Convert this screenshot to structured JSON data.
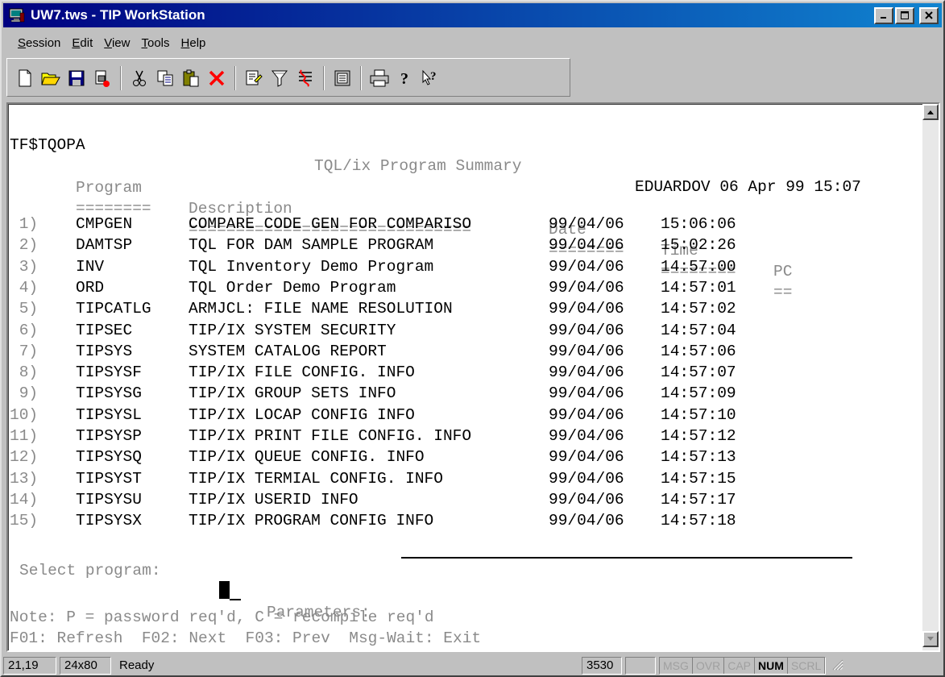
{
  "window": {
    "title": "UW7.tws - TIP WorkStation",
    "buttons": {
      "minimize": "_",
      "maximize": "□",
      "close": "✕"
    }
  },
  "menu": [
    "Session",
    "Edit",
    "View",
    "Tools",
    "Help"
  ],
  "menu_underline": [
    "S",
    "E",
    "V",
    "T",
    "H"
  ],
  "toolbar": {
    "icons": [
      "new-icon",
      "open-icon",
      "save-icon",
      "properties-icon",
      "cut-icon",
      "copy-icon",
      "paste-icon",
      "delete-icon",
      "settings-icon",
      "filter-icon",
      "macro-icon",
      "display-icon",
      "print-icon",
      "help-icon",
      "context-help-icon"
    ]
  },
  "screen": {
    "program_id": "TF$TQOPA",
    "title": "TQL/ix Program Summary",
    "user_datetime": "EDUARDOV 06 Apr 99 15:07",
    "headers": {
      "program": "Program",
      "description": "Description",
      "date": "Date",
      "time": "Time",
      "pc": "PC"
    },
    "underlines": {
      "program": "========",
      "description": "==============================",
      "date": "========",
      "time": "========",
      "pc": "=="
    },
    "rows": [
      {
        "num": " 1)",
        "program": "CMPGEN",
        "description": "COMPARE CODE GEN FOR COMPARISO",
        "date": "99/04/06",
        "time": "15:06:06"
      },
      {
        "num": " 2)",
        "program": "DAMTSP",
        "description": "TQL FOR DAM SAMPLE PROGRAM",
        "date": "99/04/06",
        "time": "15:02:26"
      },
      {
        "num": " 3)",
        "program": "INV",
        "description": "TQL Inventory Demo Program",
        "date": "99/04/06",
        "time": "14:57:00"
      },
      {
        "num": " 4)",
        "program": "ORD",
        "description": "TQL Order Demo Program",
        "date": "99/04/06",
        "time": "14:57:01"
      },
      {
        "num": " 5)",
        "program": "TIPCATLG",
        "description": "ARMJCL: FILE NAME RESOLUTION",
        "date": "99/04/06",
        "time": "14:57:02"
      },
      {
        "num": " 6)",
        "program": "TIPSEC",
        "description": "TIP/IX SYSTEM SECURITY",
        "date": "99/04/06",
        "time": "14:57:04"
      },
      {
        "num": " 7)",
        "program": "TIPSYS",
        "description": "SYSTEM CATALOG REPORT",
        "date": "99/04/06",
        "time": "14:57:06"
      },
      {
        "num": " 8)",
        "program": "TIPSYSF",
        "description": "TIP/IX FILE CONFIG. INFO",
        "date": "99/04/06",
        "time": "14:57:07"
      },
      {
        "num": " 9)",
        "program": "TIPSYSG",
        "description": "TIP/IX GROUP SETS INFO",
        "date": "99/04/06",
        "time": "14:57:09"
      },
      {
        "num": "10)",
        "program": "TIPSYSL",
        "description": "TIP/IX LOCAP CONFIG INFO",
        "date": "99/04/06",
        "time": "14:57:10"
      },
      {
        "num": "11)",
        "program": "TIPSYSP",
        "description": "TIP/IX PRINT FILE CONFIG. INFO",
        "date": "99/04/06",
        "time": "14:57:12"
      },
      {
        "num": "12)",
        "program": "TIPSYSQ",
        "description": "TIP/IX QUEUE CONFIG. INFO",
        "date": "99/04/06",
        "time": "14:57:13"
      },
      {
        "num": "13)",
        "program": "TIPSYST",
        "description": "TIP/IX TERMIAL CONFIG. INFO",
        "date": "99/04/06",
        "time": "14:57:15"
      },
      {
        "num": "14)",
        "program": "TIPSYSU",
        "description": "TIP/IX USERID INFO",
        "date": "99/04/06",
        "time": "14:57:17"
      },
      {
        "num": "15)",
        "program": "TIPSYSX",
        "description": "TIP/IX PROGRAM CONFIG INFO",
        "date": "99/04/06",
        "time": "14:57:18"
      }
    ],
    "select_label": "Select program:",
    "params_label": "Parameters:",
    "note": "Note: P = password req'd, C = recompile req'd",
    "function_keys": "F01: Refresh  F02: Next  F03: Prev  Msg-Wait: Exit"
  },
  "statusbar": {
    "cursor_pos": "21,19",
    "screen_size": "24x80",
    "status": "Ready",
    "code": "3530",
    "indicators": [
      {
        "label": "MSG",
        "on": false
      },
      {
        "label": "OVR",
        "on": false
      },
      {
        "label": "CAP",
        "on": false
      },
      {
        "label": "NUM",
        "on": true
      },
      {
        "label": "SCRL",
        "on": false
      }
    ]
  }
}
